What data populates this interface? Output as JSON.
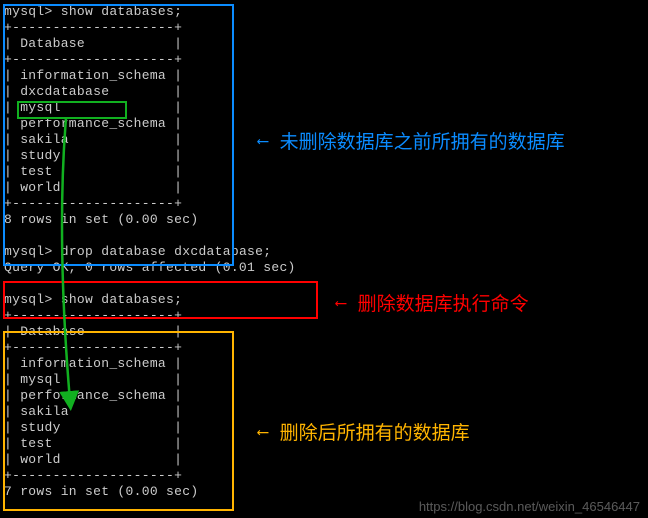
{
  "prompt": "mysql>",
  "commands": {
    "show1": "show databases;",
    "drop": "drop database dxcdatabase;",
    "drop_result": "Query OK, 0 rows affected (0.01 sec)",
    "show2": "show databases;"
  },
  "table_header": "Database",
  "border_divider": "+--------------------+",
  "before_databases": [
    "information_schema",
    "dxcdatabase",
    "mysql",
    "performance_schema",
    "sakila",
    "study",
    "test",
    "world"
  ],
  "before_summary": "8 rows in set (0.00 sec)",
  "after_databases": [
    "information_schema",
    "mysql",
    "performance_schema",
    "sakila",
    "study",
    "test",
    "world"
  ],
  "after_summary": "7 rows in set (0.00 sec)",
  "annotations": {
    "blue": "未删除数据库之前所拥有的数据库",
    "red": "删除数据库执行命令",
    "yellow": "删除后所拥有的数据库"
  },
  "highlighted_database": "dxcdatabase",
  "watermark": "https://blog.csdn.net/weixin_46546447",
  "colors": {
    "blue": "#0b8cff",
    "green": "#11b020",
    "red": "#ff0000",
    "yellow": "#ffb400"
  }
}
